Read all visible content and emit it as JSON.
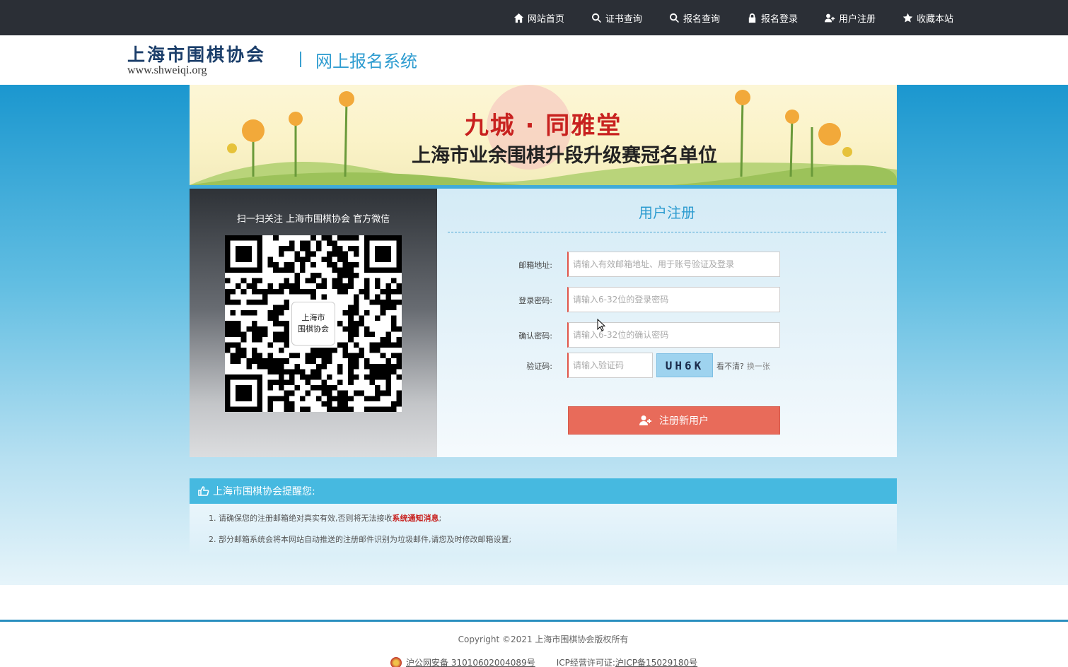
{
  "topnav": {
    "items": [
      {
        "label": "网站首页",
        "icon": "home-icon"
      },
      {
        "label": "证书查询",
        "icon": "search-icon"
      },
      {
        "label": "报名查询",
        "icon": "search-icon"
      },
      {
        "label": "报名登录",
        "icon": "lock-icon"
      },
      {
        "label": "用户注册",
        "icon": "user-plus-icon"
      },
      {
        "label": "收藏本站",
        "icon": "star-icon"
      }
    ]
  },
  "header": {
    "logo_cn": "上海市围棋协会",
    "logo_en": "www.shweiqi.org",
    "system_title": "网上报名系统"
  },
  "banner": {
    "title": "九城 · 同雅堂",
    "subtitle": "上海市业余围棋升段升级赛冠名单位"
  },
  "qr": {
    "caption": "扫一扫关注 上海市围棋协会 官方微信",
    "logo_text_line1": "上海市",
    "logo_text_line2": "围棋协会"
  },
  "form": {
    "title": "用户注册",
    "email_label": "邮箱地址:",
    "email_placeholder": "请输入有效邮箱地址、用于账号验证及登录",
    "password_label": "登录密码:",
    "password_placeholder": "请输入6-32位的登录密码",
    "confirm_label": "确认密码:",
    "confirm_placeholder": "请输入6-32位的确认密码",
    "captcha_label": "验证码:",
    "captcha_placeholder": "请输入验证码",
    "captcha_text": "UH6K",
    "captcha_hint": "看不清?",
    "captcha_refresh": "换一张",
    "submit_label": "注册新用户"
  },
  "notice": {
    "title": "上海市围棋协会提醒您:",
    "line1_prefix": "1. 请确保您的注册邮箱绝对真实有效,否则将无法接收",
    "line1_highlight": "系统通知消息",
    "line1_suffix": ";",
    "line2": "2. 部分邮箱系统会将本网站自动推送的注册邮件识别为垃圾邮件,请您及时修改邮箱设置;"
  },
  "footer": {
    "copyright": "Copyright ©2021 上海市围棋协会版权所有",
    "police_record": "沪公网安备 31010602004089号",
    "icp_label": "ICP经营许可证:",
    "icp_number": "沪ICP备15029180号"
  },
  "colors": {
    "nav_bg": "#2b2f36",
    "accent_blue": "#2e9cd0",
    "submit_red": "#e86b5a",
    "notice_bar": "#46b9e0"
  }
}
